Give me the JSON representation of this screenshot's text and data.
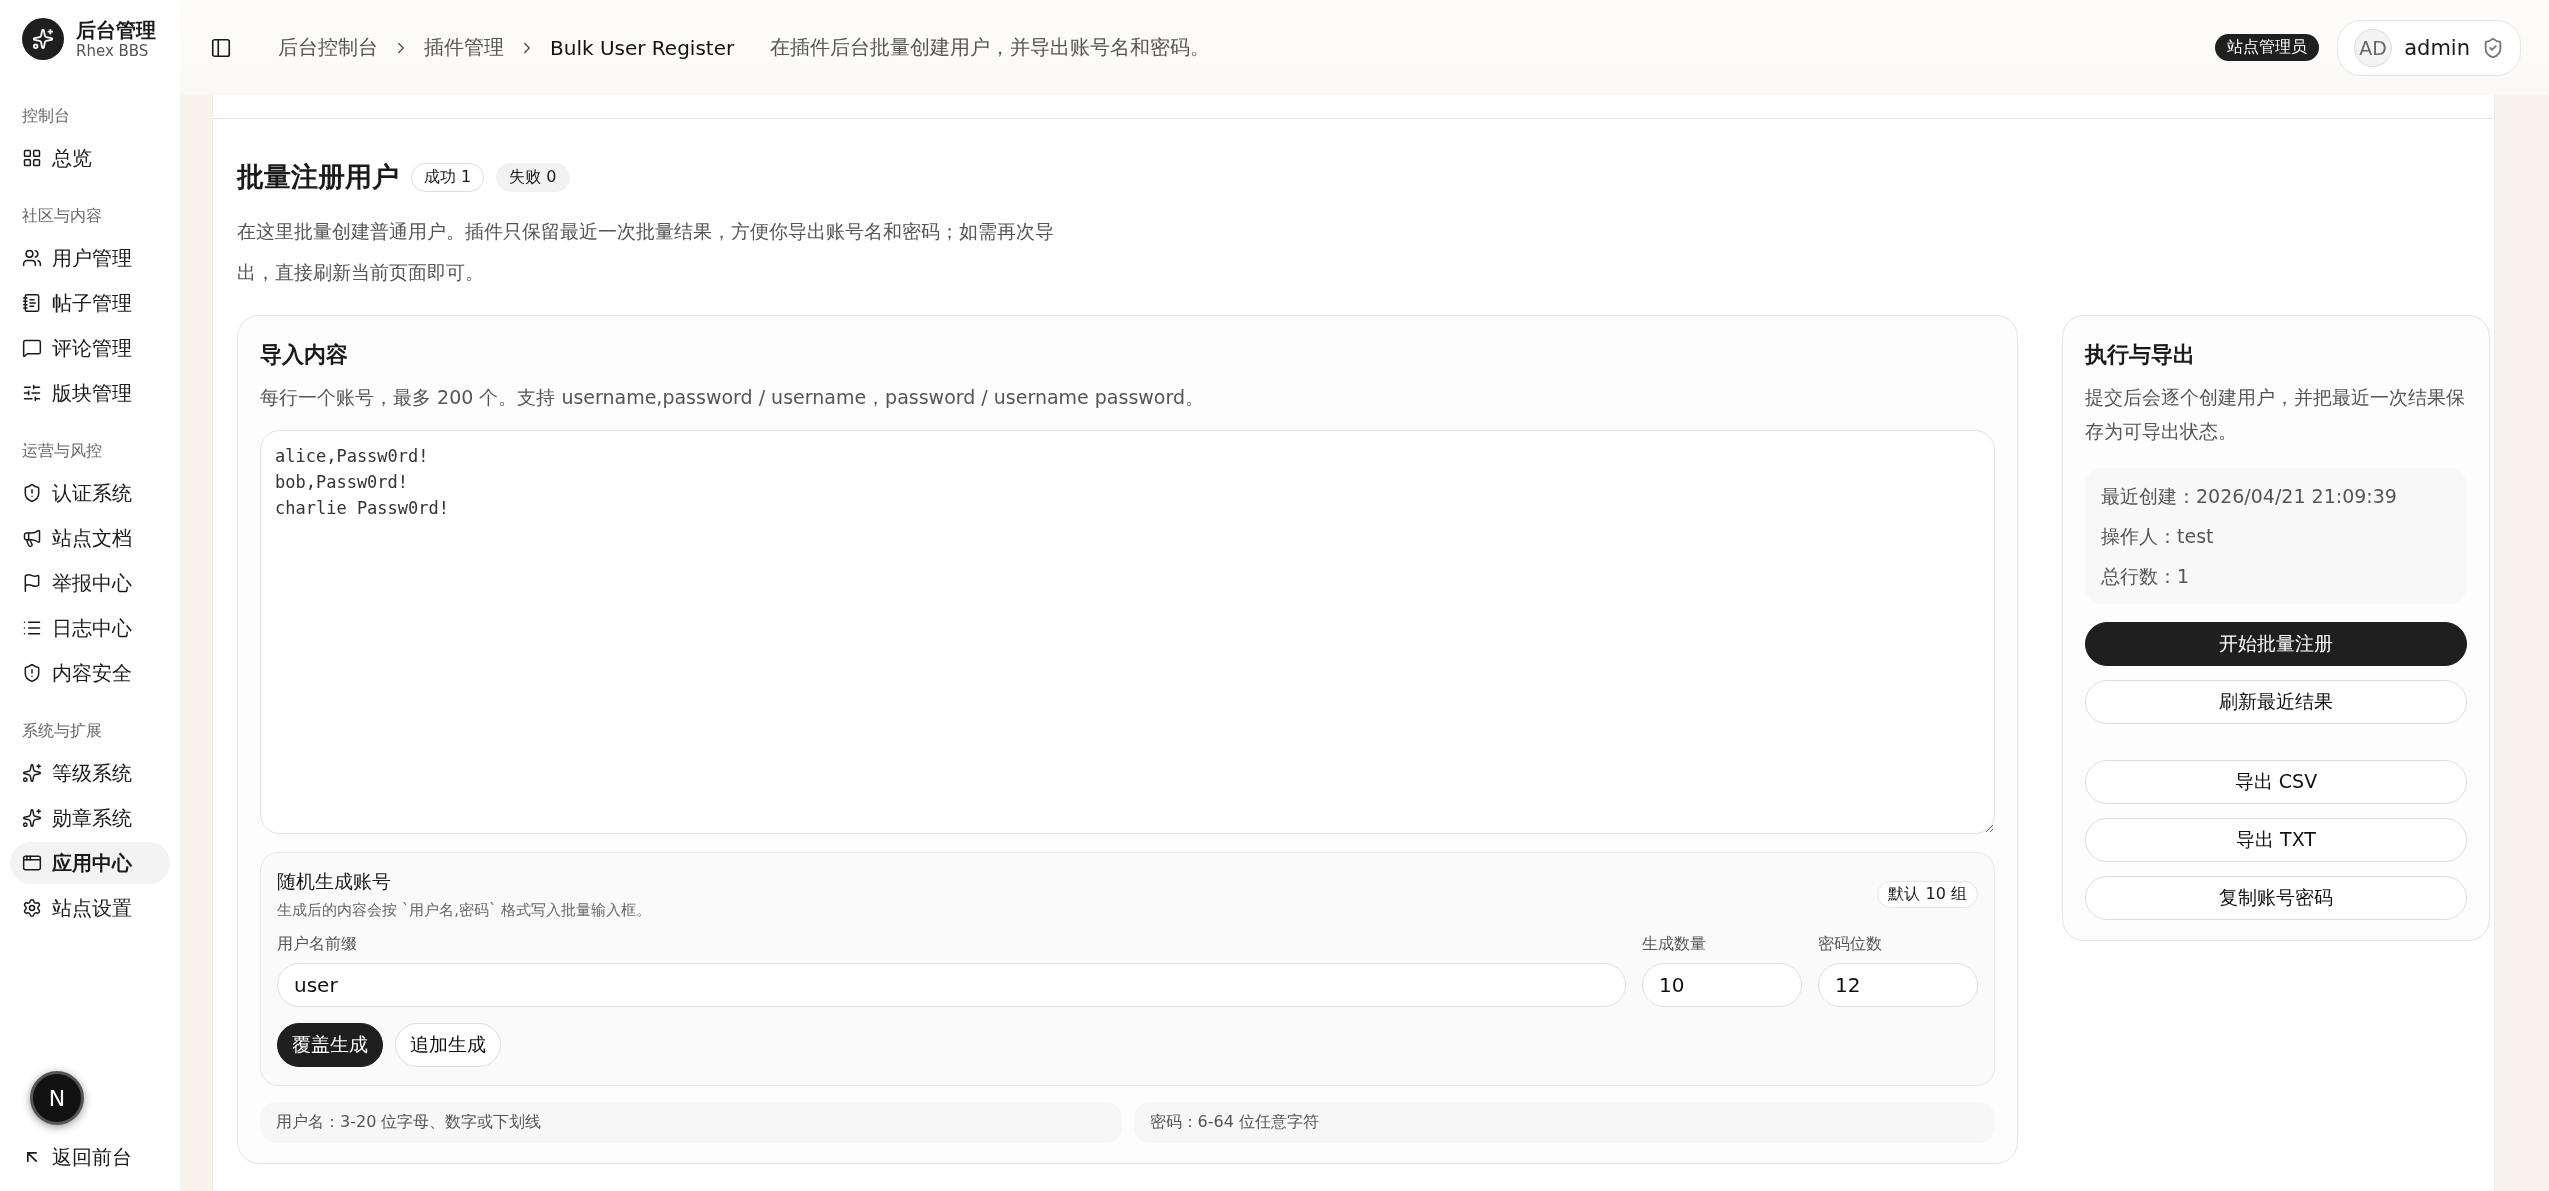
{
  "brand": {
    "title": "后台管理",
    "subtitle": "Rhex BBS"
  },
  "sidebar": {
    "sections": [
      {
        "heading": "控制台",
        "items": [
          {
            "label": "总览",
            "selected": false
          }
        ]
      },
      {
        "heading": "社区与内容",
        "items": [
          {
            "label": "用户管理",
            "selected": false
          },
          {
            "label": "帖子管理",
            "selected": false
          },
          {
            "label": "评论管理",
            "selected": false
          },
          {
            "label": "版块管理",
            "selected": false
          }
        ]
      },
      {
        "heading": "运营与风控",
        "items": [
          {
            "label": "认证系统",
            "selected": false
          },
          {
            "label": "站点文档",
            "selected": false
          },
          {
            "label": "举报中心",
            "selected": false
          },
          {
            "label": "日志中心",
            "selected": false
          },
          {
            "label": "内容安全",
            "selected": false
          }
        ]
      },
      {
        "heading": "系统与扩展",
        "items": [
          {
            "label": "等级系统",
            "selected": false
          },
          {
            "label": "勋章系统",
            "selected": false
          },
          {
            "label": "应用中心",
            "selected": true
          },
          {
            "label": "站点设置",
            "selected": false
          }
        ]
      }
    ],
    "footer_link": "返回前台"
  },
  "dev_badge": "N",
  "header": {
    "breadcrumbs": [
      "后台控制台",
      "插件管理",
      "Bulk User Register"
    ],
    "description": "在插件后台批量创建用户，并导出账号名和密码。",
    "role_badge": "站点管理员",
    "user": {
      "initials": "AD",
      "name": "admin"
    }
  },
  "page": {
    "title": "批量注册用户",
    "stats": [
      {
        "label": "成功 1",
        "kind": "success"
      },
      {
        "label": "失败 0",
        "kind": "failure"
      }
    ],
    "description": "在这里批量创建普通用户。插件只保留最近一次批量结果，方便你导出账号名和密码；如需再次导出，直接刷新当前页面即可。"
  },
  "import": {
    "title": "导入内容",
    "description": "每行一个账号，最多 200 个。支持 username,password / username，password / username password。",
    "textarea_value": "alice,Passw0rd!\nbob,Passw0rd!\ncharlie Passw0rd!"
  },
  "generator": {
    "title": "随机生成账号",
    "subtitle": "生成后的内容会按 `用户名,密码` 格式写入批量输入框。",
    "badge": "默认 10 组",
    "fields": [
      {
        "label": "用户名前缀",
        "value": "user",
        "kind": "wide"
      },
      {
        "label": "生成数量",
        "value": "10",
        "kind": "narrow"
      },
      {
        "label": "密码位数",
        "value": "12",
        "kind": "narrow"
      }
    ],
    "buttons": [
      {
        "label": "覆盖生成",
        "primary": true
      },
      {
        "label": "追加生成",
        "primary": false
      }
    ]
  },
  "hints": [
    "用户名：3-20 位字母、数字或下划线",
    "密码：6-64 位任意字符"
  ],
  "export_panel": {
    "title": "执行与导出",
    "description": "提交后会逐个创建用户，并把最近一次结果保存为可导出状态。",
    "info": [
      "最近创建：2026/04/21 21:09:39",
      "操作人：test",
      "总行数：1"
    ],
    "actions": [
      {
        "label": "开始批量注册",
        "primary": true
      },
      {
        "label": "刷新最近结果",
        "primary": false
      }
    ],
    "exports": [
      {
        "label": "导出 CSV",
        "primary": false
      },
      {
        "label": "导出 TXT",
        "primary": false
      },
      {
        "label": "复制账号密码",
        "primary": false
      }
    ]
  }
}
